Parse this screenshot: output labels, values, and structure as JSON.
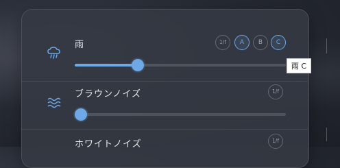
{
  "rows": [
    {
      "title": "雨",
      "icon": "rain-cloud-icon",
      "chips": [
        {
          "label": "1/f",
          "selected": false
        },
        {
          "label": "A",
          "selected": true
        },
        {
          "label": "B",
          "selected": false
        },
        {
          "label": "C",
          "selected": true
        }
      ],
      "level": 0.3
    },
    {
      "title": "ブラウンノイズ",
      "icon": "waves-icon",
      "chips": [
        {
          "label": "1/f",
          "selected": false
        }
      ],
      "level": 0.0
    },
    {
      "title": "ホワイトノイズ",
      "chips": [
        {
          "label": "1/f",
          "selected": false
        }
      ]
    }
  ],
  "tooltip": {
    "text": "雨 C"
  },
  "colors": {
    "accent": "#6ea8e6",
    "panel": "#343842",
    "text": "#e6e8ec"
  }
}
